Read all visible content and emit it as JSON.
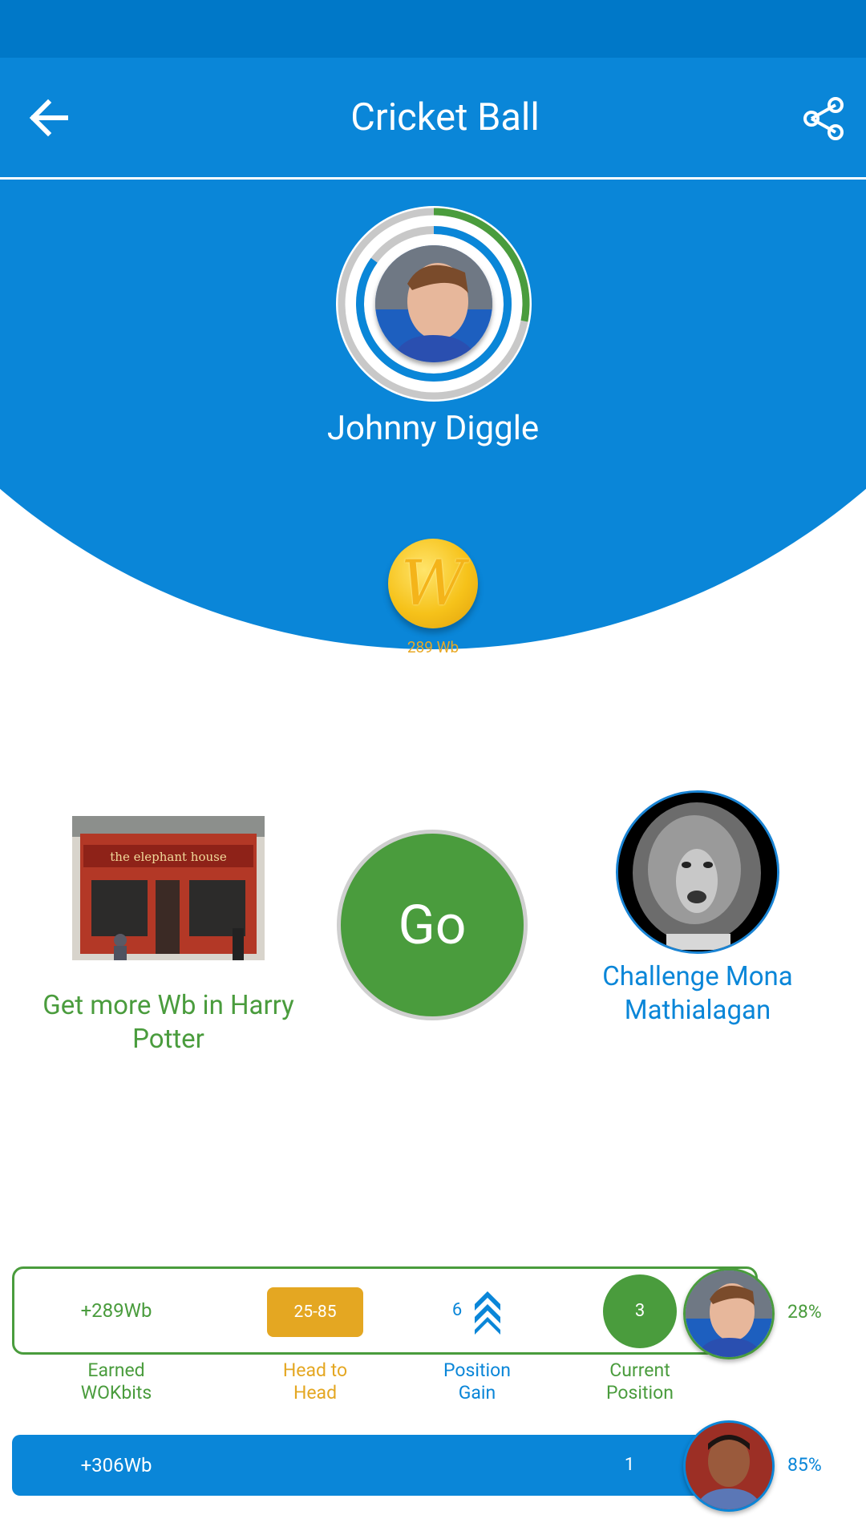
{
  "header": {
    "title": "Cricket Ball",
    "back_icon": "arrow-left-icon",
    "share_icon": "share-icon",
    "bar_color": "#0a86d8",
    "status_color": "#0078c8"
  },
  "profile": {
    "name": "Johnny Diggle",
    "coin_icon": "wokbits-coin-icon",
    "coin_letter": "W",
    "coin_label": "289 Wb",
    "ring_outer_progress": 0.28,
    "ring_inner_progress": 0.85,
    "ring_outer_color": "#4a9c3d",
    "ring_inner_color": "#0a86d8"
  },
  "actions": {
    "promo_text": "Get more Wb in Harry Potter",
    "go_label": "Go",
    "challenge_text": "Challenge Mona Mathialagan",
    "promo_image_sign": "the elephant house"
  },
  "scores": {
    "row1": {
      "earned": "+289Wb",
      "head_to_head": "25-85",
      "position_gain": "6",
      "current_position": "3",
      "percent": "28%",
      "gain_icon": "double-chevron-up-icon"
    },
    "row2": {
      "earned": "+306Wb",
      "current_position": "1",
      "percent": "85%"
    },
    "labels": {
      "earned": "Earned\nWOKbits",
      "head_to_head": "Head to\nHead",
      "position_gain": "Position\nGain",
      "current_position": "Current\nPosition"
    },
    "colors": {
      "green": "#4a9c3d",
      "orange": "#e4a722",
      "blue": "#0a86d8"
    }
  }
}
